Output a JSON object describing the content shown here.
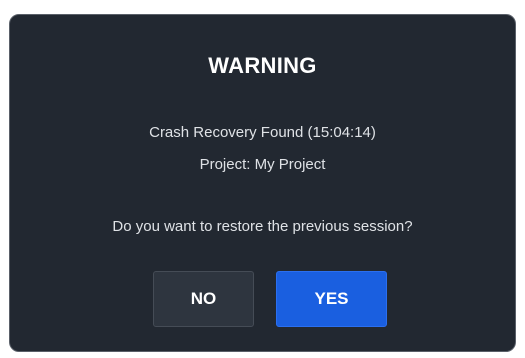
{
  "dialog": {
    "title": "WARNING",
    "message_line1": "Crash Recovery Found (15:04:14)",
    "message_line2": "Project: My Project",
    "question": "Do you want to restore the previous session?",
    "no_label": "NO",
    "yes_label": "YES"
  },
  "colors": {
    "background": "#222831",
    "primary_button": "#1a5fe0",
    "secondary_button": "#2e353f"
  }
}
